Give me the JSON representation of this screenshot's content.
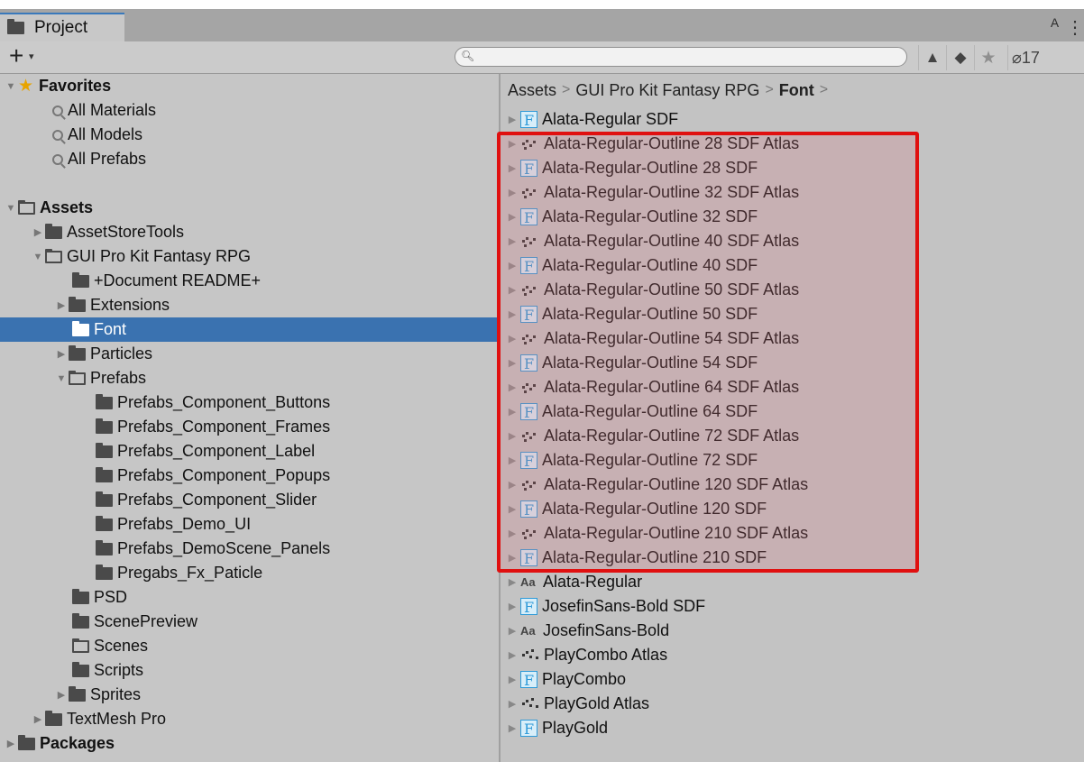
{
  "window": {
    "tab_title": "Project",
    "tab_icon": "folder-icon",
    "lock_glyph": "ᴬ",
    "menu_glyph": "⋮"
  },
  "toolbar": {
    "create_glyph": "+",
    "create_dropdown_glyph": "▾",
    "search_placeholder": "",
    "hidden_count": "17"
  },
  "tree": {
    "favorites": {
      "label": "Favorites",
      "items": [
        "All Materials",
        "All Models",
        "All Prefabs"
      ]
    },
    "assets": {
      "label": "Assets",
      "asset_store_tools": "AssetStoreTools",
      "gui_pro_kit": "GUI Pro Kit Fantasy RPG",
      "readme": "+Document README+",
      "extensions": "Extensions",
      "font": "Font",
      "particles": "Particles",
      "prefabs": "Prefabs",
      "prefab_children": [
        "Prefabs_Component_Buttons",
        "Prefabs_Component_Frames",
        "Prefabs_Component_Label",
        "Prefabs_Component_Popups",
        "Prefabs_Component_Slider",
        "Prefabs_Demo_UI",
        "Prefabs_DemoScene_Panels",
        "Pregabs_Fx_Paticle"
      ],
      "psd": "PSD",
      "scene_preview": "ScenePreview",
      "scenes": "Scenes",
      "scripts": "Scripts",
      "sprites": "Sprites",
      "textmesh": "TextMesh Pro"
    },
    "packages": {
      "label": "Packages"
    }
  },
  "breadcrumb": {
    "items": [
      "Assets",
      "GUI Pro Kit Fantasy RPG",
      "Font"
    ],
    "separator": ">"
  },
  "files": [
    {
      "name": "Alata-Regular SDF",
      "icon": "f-font-icon"
    },
    {
      "name": "Alata-Regular-Outline 28 SDF Atlas",
      "icon": "atlas-icon"
    },
    {
      "name": "Alata-Regular-Outline 28 SDF",
      "icon": "f-font-icon"
    },
    {
      "name": "Alata-Regular-Outline 32 SDF Atlas",
      "icon": "atlas-icon"
    },
    {
      "name": "Alata-Regular-Outline 32 SDF",
      "icon": "f-font-icon"
    },
    {
      "name": "Alata-Regular-Outline 40 SDF Atlas",
      "icon": "atlas-icon"
    },
    {
      "name": "Alata-Regular-Outline 40 SDF",
      "icon": "f-font-icon"
    },
    {
      "name": "Alata-Regular-Outline 50 SDF Atlas",
      "icon": "atlas-icon"
    },
    {
      "name": "Alata-Regular-Outline 50 SDF",
      "icon": "f-font-icon"
    },
    {
      "name": "Alata-Regular-Outline 54 SDF Atlas",
      "icon": "atlas-icon"
    },
    {
      "name": "Alata-Regular-Outline 54 SDF",
      "icon": "f-font-icon"
    },
    {
      "name": "Alata-Regular-Outline 64 SDF Atlas",
      "icon": "atlas-icon"
    },
    {
      "name": "Alata-Regular-Outline 64 SDF",
      "icon": "f-font-icon"
    },
    {
      "name": "Alata-Regular-Outline 72 SDF Atlas",
      "icon": "atlas-icon"
    },
    {
      "name": "Alata-Regular-Outline 72 SDF",
      "icon": "f-font-icon"
    },
    {
      "name": "Alata-Regular-Outline 120 SDF Atlas",
      "icon": "atlas-icon"
    },
    {
      "name": "Alata-Regular-Outline 120 SDF",
      "icon": "f-font-icon"
    },
    {
      "name": "Alata-Regular-Outline 210 SDF Atlas",
      "icon": "atlas-icon"
    },
    {
      "name": "Alata-Regular-Outline 210 SDF",
      "icon": "f-font-icon"
    },
    {
      "name": "Alata-Regular",
      "icon": "aa-font-icon"
    },
    {
      "name": "JosefinSans-Bold SDF",
      "icon": "f-font-icon"
    },
    {
      "name": "JosefinSans-Bold",
      "icon": "aa-font-icon"
    },
    {
      "name": "PlayCombo Atlas",
      "icon": "atlas-icon"
    },
    {
      "name": "PlayCombo",
      "icon": "f-font-icon"
    },
    {
      "name": "PlayGold Atlas",
      "icon": "atlas-icon"
    },
    {
      "name": "PlayGold",
      "icon": "f-font-icon"
    }
  ],
  "font_icon_glyph": "F",
  "aa_icon_glyph": "Aa",
  "colors": {
    "selection": "#3a72b0",
    "highlight_border": "#e01010",
    "tab_accent": "#3a79bb",
    "font_icon": "#2f9ad8"
  }
}
